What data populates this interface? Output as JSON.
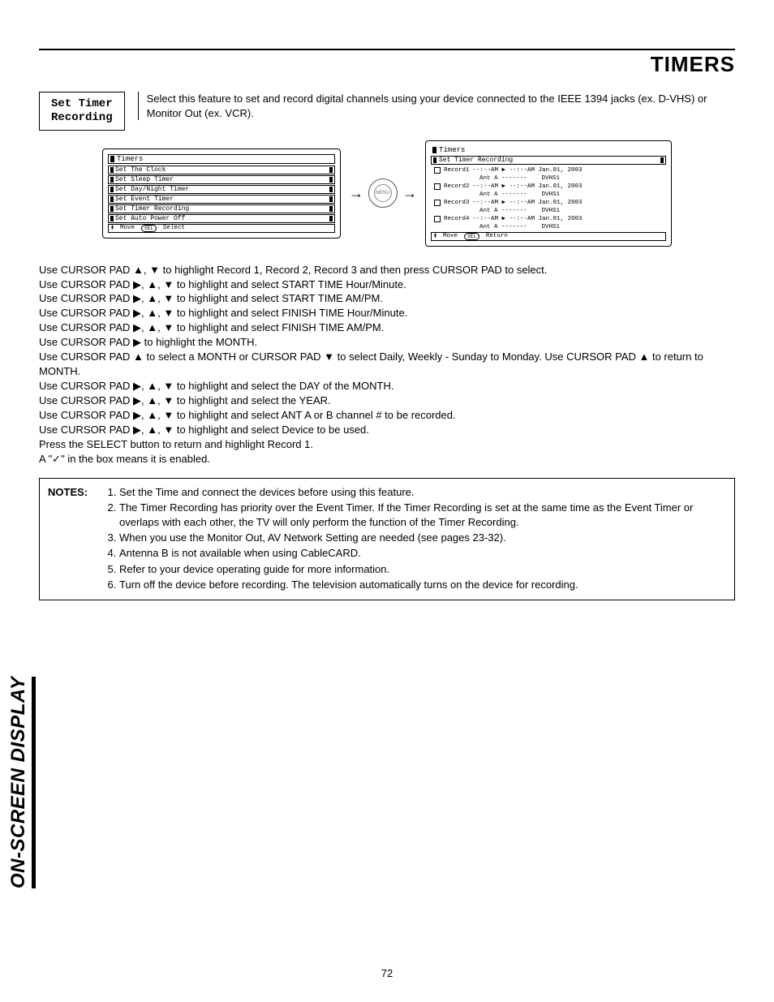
{
  "page_title": "TIMERS",
  "feature_box": "Set Timer\nRecording",
  "intro_text": "Select this feature to set and record digital channels using your device connected to the IEEE 1394 jacks (ex. D-VHS) or Monitor Out (ex. VCR).",
  "osd_left": {
    "title": "Timers",
    "items": [
      "Set The Clock",
      "Set Sleep Timer",
      "Set Day/Night Timer",
      "Set Event Timer",
      "Set Timer Recording",
      "Set Auto Power Off"
    ],
    "footer_move": "Move",
    "footer_sel": "SEL",
    "footer_select": "Select"
  },
  "menu_label": "MENU",
  "osd_right": {
    "top_title": "Timers",
    "header": "Set Timer Recording",
    "records": [
      {
        "name": "Record1",
        "line1": "--:--AM ▶ --:--AM Jan.01, 2003",
        "line2": "Ant A -------    DVHS1"
      },
      {
        "name": "Record2",
        "line1": "--:--AM ▶ --:--AM Jan.01, 2003",
        "line2": "Ant A -------    DVHS1"
      },
      {
        "name": "Record3",
        "line1": "--:--AM ▶ --:--AM Jan.01, 2003",
        "line2": "Ant A -------    DVHS1"
      },
      {
        "name": "Record4",
        "line1": "--:--AM ▶ --:--AM Jan.01, 2003",
        "line2": "Ant A -------    DVHS1"
      }
    ],
    "footer_move": "Move",
    "footer_sel": "SEL",
    "footer_return": "Return"
  },
  "instructions": [
    "Use CURSOR PAD ▲, ▼ to highlight Record 1, Record 2, Record 3 and then press CURSOR PAD to select.",
    "Use CURSOR PAD ▶, ▲, ▼ to highlight and select START TIME Hour/Minute.",
    "Use CURSOR PAD ▶, ▲, ▼ to highlight and select START TIME AM/PM.",
    "Use CURSOR PAD ▶, ▲, ▼ to highlight and select FINISH TIME Hour/Minute.",
    "Use CURSOR PAD ▶, ▲, ▼ to highlight and select FINISH TIME AM/PM.",
    "Use CURSOR PAD ▶ to highlight the MONTH.",
    "Use CURSOR PAD ▲ to select a MONTH or CURSOR PAD ▼ to select Daily, Weekly - Sunday to Monday.  Use CURSOR PAD ▲ to return to MONTH.",
    "Use CURSOR PAD ▶, ▲, ▼ to highlight and select the DAY of the MONTH.",
    "Use CURSOR PAD ▶, ▲, ▼ to highlight and select the YEAR.",
    "Use CURSOR PAD ▶, ▲, ▼ to highlight and select ANT A or B channel # to be recorded.",
    "Use CURSOR PAD ▶, ▲, ▼ to highlight and select Device to be used.",
    "Press the SELECT button to return and highlight Record 1.",
    "A \"✓\" in the box means it is enabled."
  ],
  "notes_label": "NOTES:",
  "notes": [
    "Set the Time and connect the devices before using this feature.",
    "The Timer Recording has priority over the Event Timer.  If the Timer Recording is set at the same time as the Event Timer or overlaps with each other, the TV will only perform the function of the Timer Recording.",
    "When you use the Monitor Out, AV Network Setting are needed (see pages 23-32).",
    "Antenna B is not available when using CableCARD.",
    "Refer to your device operating guide for more information.",
    "Turn off the device before recording. The television automatically turns on the device for recording."
  ],
  "side_label": "ON-SCREEN DISPLAY",
  "page_number": "72"
}
